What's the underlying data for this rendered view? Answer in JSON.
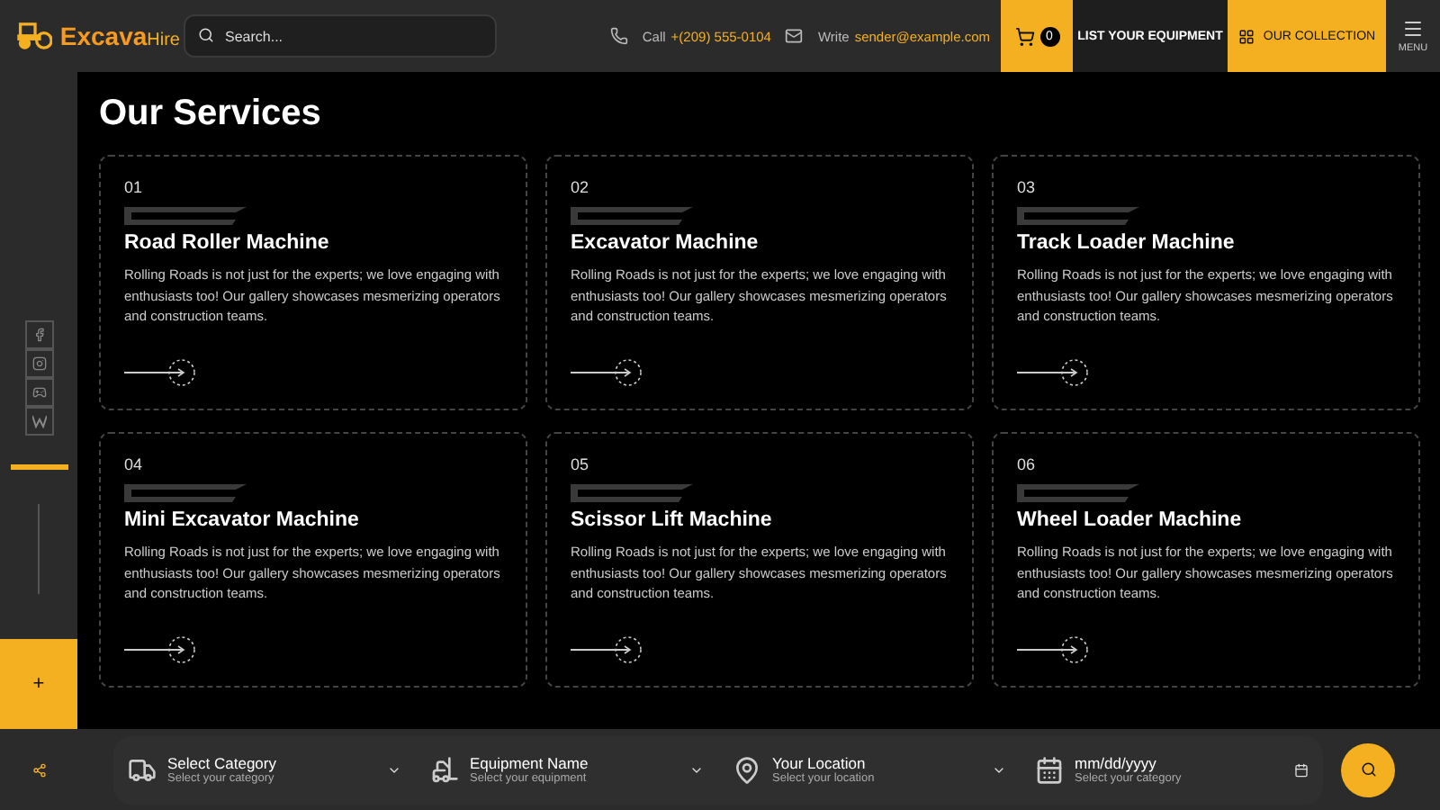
{
  "header": {
    "logo": {
      "main": "Excava",
      "accent": "Hire"
    },
    "search": {
      "placeholder": "Search..."
    },
    "call": {
      "label": "Call",
      "value": "+(209) 555-0104"
    },
    "write": {
      "label": "Write",
      "value": "sender@example.com"
    },
    "cart_count": "0",
    "list_button": "LIST YOUR EQUIPMENT",
    "collection_button": "OUR COLLECTION",
    "menu_label": "MENU"
  },
  "sidebar": {
    "progress": {
      "level": 1
    },
    "add_button": "+"
  },
  "section_title": "Our Services",
  "services": [
    {
      "number": "01",
      "title": "Road Roller Machine",
      "description": "Rolling Roads is not just for the experts; we love engaging with enthusiasts too! Our gallery showcases mesmerizing operators and construction teams."
    },
    {
      "number": "02",
      "title": "Excavator Machine",
      "description": "Rolling Roads is not just for the experts; we love engaging with enthusiasts too! Our gallery showcases mesmerizing operators and construction teams."
    },
    {
      "number": "03",
      "title": "Track Loader Machine",
      "description": "Rolling Roads is not just for the experts; we love engaging with enthusiasts too! Our gallery showcases mesmerizing operators and construction teams."
    },
    {
      "number": "04",
      "title": "Mini Excavator Machine",
      "description": "Rolling Roads is not just for the experts; we love engaging with enthusiasts too! Our gallery showcases mesmerizing operators and construction teams."
    },
    {
      "number": "05",
      "title": "Scissor Lift Machine",
      "description": "Rolling Roads is not just for the experts; we love engaging with enthusiasts too! Our gallery showcases mesmerizing operators and construction teams."
    },
    {
      "number": "06",
      "title": "Wheel Loader Machine",
      "description": "Rolling Roads is not just for the experts; we love engaging with enthusiasts too! Our gallery showcases mesmerizing operators and construction teams."
    }
  ],
  "filters": [
    {
      "kind": "category",
      "label": "Select Category",
      "hint": "Select your category"
    },
    {
      "kind": "equipment",
      "label": "Equipment Name",
      "hint": "Select your equipment"
    },
    {
      "kind": "location",
      "label": "Your Location",
      "hint": "Select your location"
    },
    {
      "kind": "date",
      "label": "mm/dd/yyyy",
      "hint": "Select your category"
    }
  ]
}
